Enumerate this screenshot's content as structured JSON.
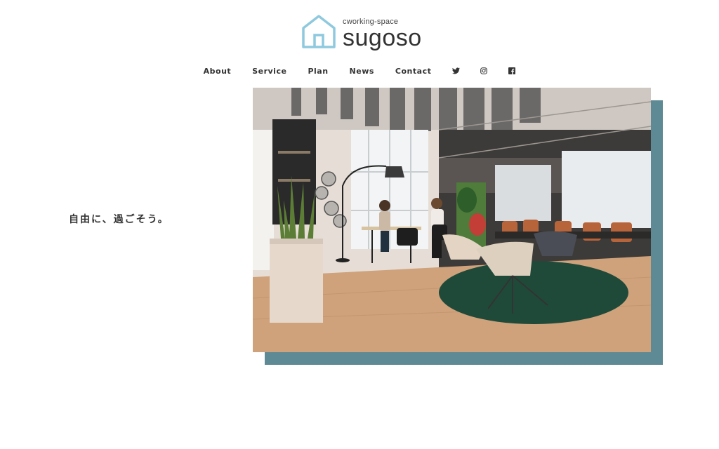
{
  "logo": {
    "subtitle": "cworking-space",
    "title": "sugoso",
    "icon": "house-icon",
    "icon_color": "#8ec9de"
  },
  "nav": {
    "items": [
      {
        "label": "About"
      },
      {
        "label": "Service"
      },
      {
        "label": "Plan"
      },
      {
        "label": "News"
      },
      {
        "label": "Contact"
      }
    ],
    "social": [
      {
        "icon": "twitter-icon"
      },
      {
        "icon": "instagram-icon"
      },
      {
        "icon": "facebook-icon"
      }
    ]
  },
  "hero": {
    "tagline": "自由に、過ごそう。",
    "image_subject": "coworking lounge photo",
    "accent_color": "#5e8a95"
  }
}
